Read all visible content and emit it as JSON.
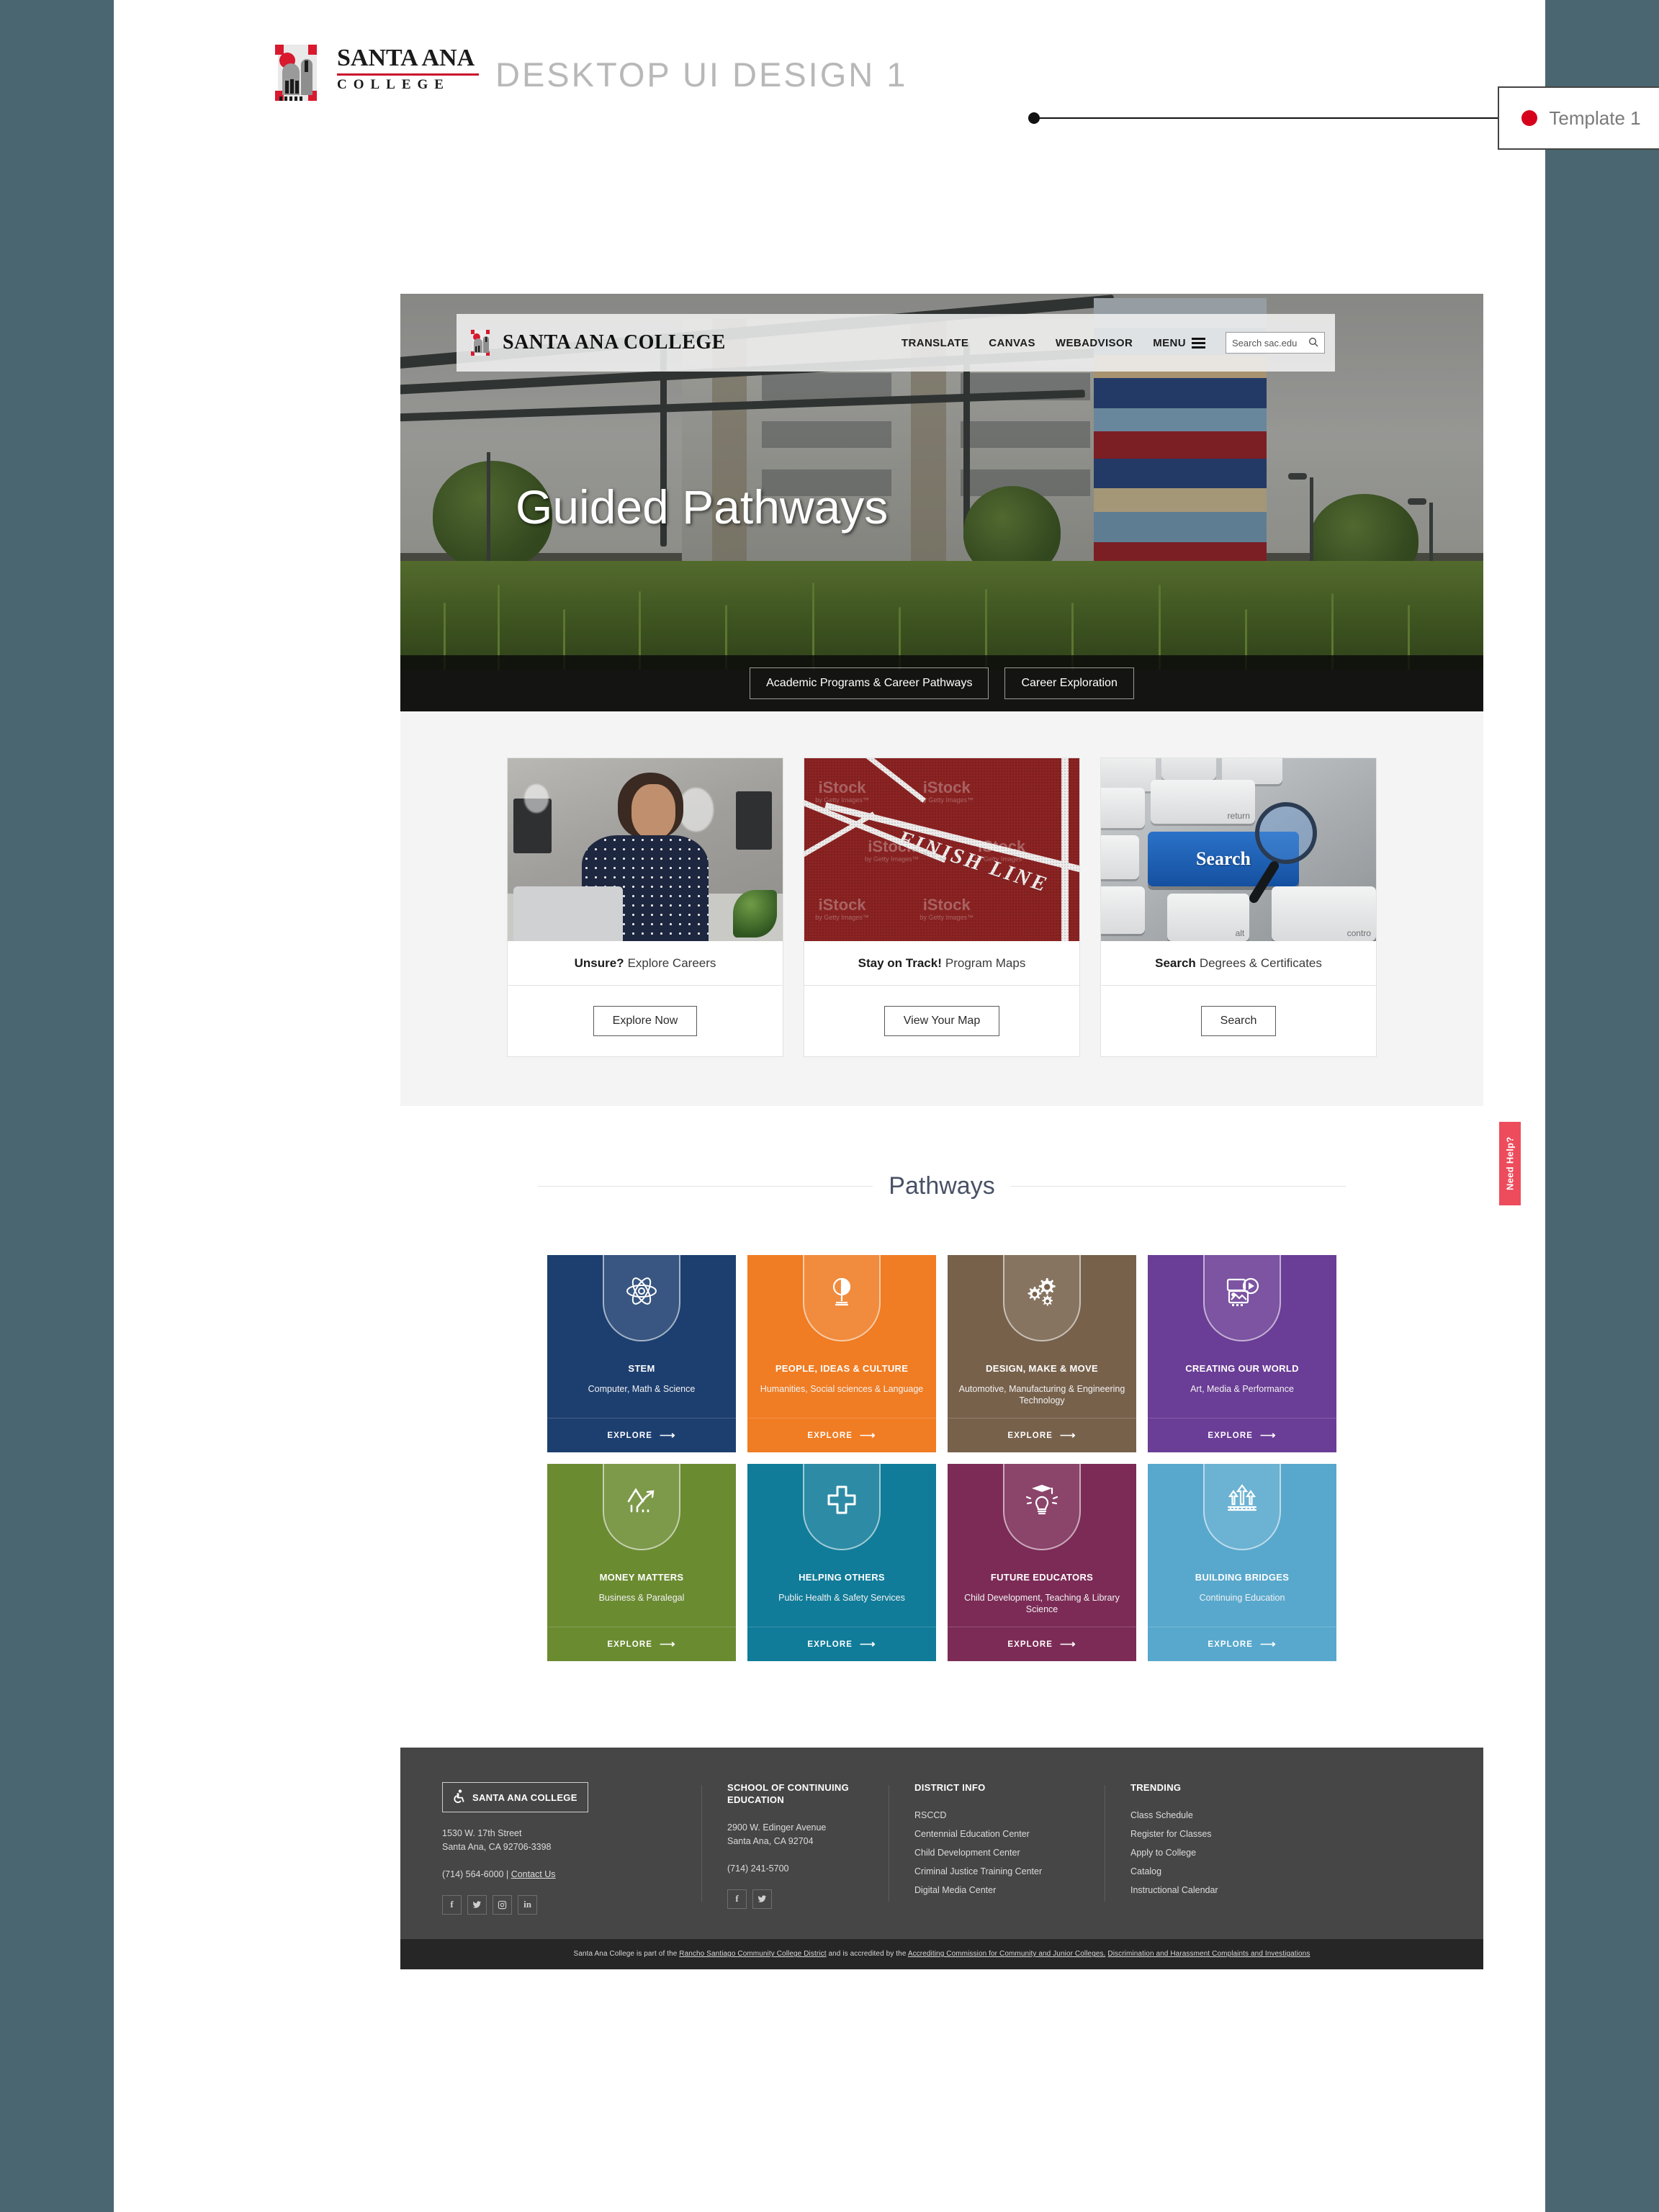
{
  "topbar": {
    "logo_santa": "SANTA ANA",
    "logo_college": "COLLEGE",
    "title": "DESKTOP UI DESIGN 1",
    "template_badge": "Template 1",
    "template_dot_color": "#d6001c"
  },
  "site_header": {
    "brand": "SANTA ANA COLLEGE",
    "nav": [
      {
        "label": "TRANSLATE"
      },
      {
        "label": "CANVAS"
      },
      {
        "label": "WEBADVISOR"
      },
      {
        "label": "MENU"
      }
    ],
    "search_placeholder": "Search sac.edu"
  },
  "hero": {
    "title": "Guided Pathways",
    "buttons": [
      {
        "label": "Academic Programs & Career Pathways"
      },
      {
        "label": "Career Exploration"
      }
    ]
  },
  "side_tab": {
    "label": "Need Help?"
  },
  "cards": [
    {
      "title_bold": "Unsure?",
      "title_rest": "Explore Careers",
      "button": "Explore Now",
      "image_alt": "woman-at-laptop-photo"
    },
    {
      "title_bold": "Stay on Track!",
      "title_rest": "Program Maps",
      "button": "View Your Map",
      "image_alt": "running-track-finish-line-photo",
      "image_text": "FINISH LINE",
      "watermark_line1": "iStock",
      "watermark_line2": "by Getty Images™"
    },
    {
      "title_bold": "Search",
      "title_rest": "Degrees & Certificates",
      "button": "Search",
      "image_alt": "keyboard-search-key-photo",
      "image_text": "Search",
      "key_return": "return",
      "key_alt": "alt",
      "key_control": "contro"
    }
  ],
  "pathways": {
    "heading": "Pathways",
    "tiles": [
      {
        "name": "STEM",
        "desc": "Computer, Math & Science",
        "cta": "EXPLORE",
        "color": "#1d3f70",
        "icon": "atom-icon"
      },
      {
        "name": "PEOPLE, IDEAS & CULTURE",
        "desc": "Humanities, Social sciences & Language",
        "cta": "EXPLORE",
        "color": "#f07c23",
        "icon": "globe-icon"
      },
      {
        "name": "DESIGN, MAKE & MOVE",
        "desc": "Automotive, Manufacturing & Engineering Technology",
        "cta": "EXPLORE",
        "color": "#77614b",
        "icon": "gears-icon"
      },
      {
        "name": "CREATING OUR WORLD",
        "desc": "Art, Media & Performance",
        "cta": "EXPLORE",
        "color": "#6a3d96",
        "icon": "media-icon"
      },
      {
        "name": "MONEY MATTERS",
        "desc": "Business & Paralegal",
        "cta": "EXPLORE",
        "color": "#6b8b31",
        "icon": "growth-chart-icon"
      },
      {
        "name": "HELPING OTHERS",
        "desc": "Public Health & Safety Services",
        "cta": "EXPLORE",
        "color": "#107c99",
        "icon": "medical-cross-icon"
      },
      {
        "name": "FUTURE EDUCATORS",
        "desc": "Child Development, Teaching & Library Science",
        "cta": "EXPLORE",
        "color": "#7c2b56",
        "icon": "graduate-bulb-icon"
      },
      {
        "name": "BUILDING BRIDGES",
        "desc": "Continuing Education",
        "cta": "EXPLORE",
        "color": "#58a8cd",
        "icon": "bridge-icon"
      }
    ]
  },
  "footer": {
    "col1": {
      "badge": "SANTA ANA COLLEGE",
      "address_line1": "1530 W. 17th Street",
      "address_line2": "Santa Ana, CA 92706-3398",
      "phone": "(714) 564-6000 |",
      "contact_link": "Contact Us",
      "social": [
        "facebook-icon",
        "twitter-icon",
        "instagram-icon",
        "linkedin-icon"
      ]
    },
    "col2": {
      "heading": "SCHOOL OF CONTINUING EDUCATION",
      "address_line1": "2900 W. Edinger Avenue",
      "address_line2": "Santa Ana, CA 92704",
      "phone": "(714) 241-5700",
      "social": [
        "facebook-icon",
        "twitter-icon"
      ]
    },
    "col3": {
      "heading": "DISTRICT INFO",
      "links": [
        "RSCCD",
        "Centennial Education Center",
        "Child Development Center",
        "Criminal Justice Training Center",
        "Digital Media Center"
      ]
    },
    "col4": {
      "heading": "TRENDING",
      "links": [
        "Class Schedule",
        "Register for Classes",
        "Apply to College",
        "Catalog",
        "Instructional Calendar"
      ]
    },
    "legal": {
      "part1": "Santa Ana College is part of the ",
      "link1": "Rancho Santiago Community College District",
      "part2": " and is accredited by the ",
      "link2": "Accrediting Commission for Community and Junior Colleges.",
      "link3": "Discrimination and Harassment Complaints and Investigations"
    }
  }
}
